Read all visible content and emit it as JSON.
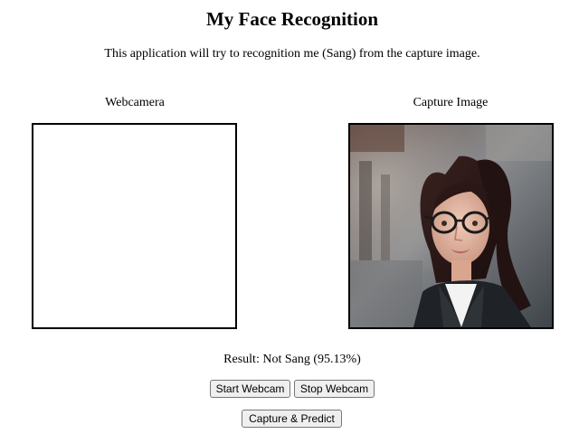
{
  "page": {
    "title": "My Face Recognition",
    "description": "This application will try to recognition me (Sang) from the capture image."
  },
  "webcam": {
    "label": "Webcamera"
  },
  "capture": {
    "label": "Capture Image"
  },
  "result": {
    "text": "Result: Not Sang (95.13%)"
  },
  "buttons": {
    "start_webcam": "Start Webcam",
    "stop_webcam": "Stop Webcam",
    "capture_predict": "Capture & Predict"
  }
}
